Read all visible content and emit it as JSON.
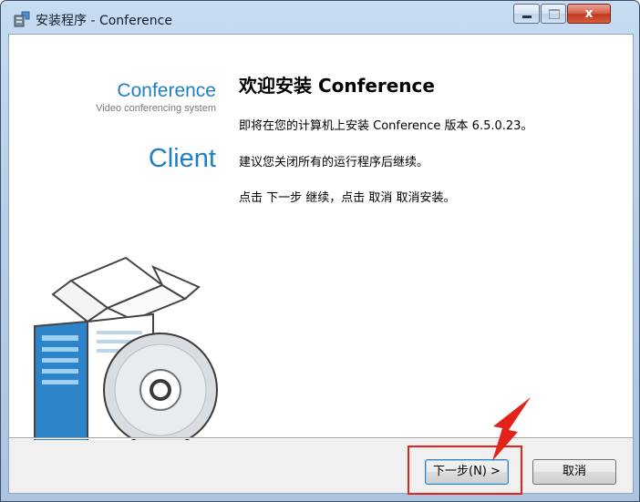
{
  "window": {
    "title": "安装程序 - Conference",
    "controls": {
      "minimize_icon": "minimize-icon",
      "maximize_icon": "maximize-icon",
      "close_icon": "close-icon",
      "close_glyph": "x"
    }
  },
  "sidebar": {
    "brand_name": "Conference",
    "brand_subtitle": "Video conferencing system",
    "brand_client": "Client",
    "art_icon": "software-box-cd-icon"
  },
  "main": {
    "heading": "欢迎安装 Conference",
    "lines": [
      "即将在您的计算机上安装 Conference 版本 6.5.0.23。",
      "建议您关闭所有的运行程序后继续。",
      "点击 下一步 继续，点击 取消 取消安装。"
    ]
  },
  "buttons": {
    "next_label": "下一步(N) >",
    "cancel_label": "取消"
  },
  "annotation": {
    "highlight_color": "#e3231a",
    "arrow_color": "#e3231a"
  },
  "colors": {
    "brand": "#1f7fc4",
    "titlebar": "#b7cfe9",
    "close": "#c2381f"
  }
}
